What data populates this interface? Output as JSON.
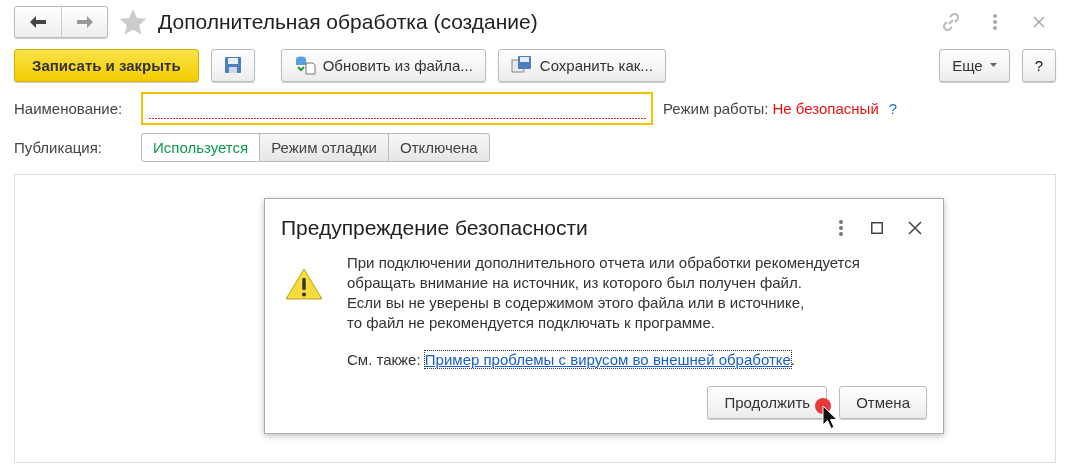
{
  "window": {
    "title": "Дополнительная обработка (создание)",
    "favorite": false
  },
  "toolbar": {
    "primary_button": "Записать и закрыть",
    "buttons": [
      {
        "kind": "save"
      },
      {
        "kind": "load",
        "label": "Обновить из файла..."
      },
      {
        "kind": "saveas",
        "label": "Сохранить как..."
      }
    ],
    "more_button": "Еще",
    "help_button": "?"
  },
  "name_field": {
    "label": "Наименование:",
    "required": true
  },
  "mode": {
    "label": "Режим работы:",
    "value": "Не безопасный",
    "help": "?"
  },
  "publication": {
    "label": "Публикация:",
    "options": [
      {
        "label": "Используется",
        "selected": true
      },
      {
        "label": "Режим отладки",
        "selected": false
      },
      {
        "label": "Отключена",
        "selected": false
      }
    ]
  },
  "dialog": {
    "title": "Предупреждение безопасности",
    "message_lines": [
      "При подключении дополнительного отчета или обработки рекомендуется",
      "обращать внимание на источник, из которого был получен файл.",
      "Если вы не уверены в содержимом этого файла или в источнике,",
      "то файл не рекомендуется подключать к программе."
    ],
    "see_also": "См. также:",
    "link": "Пример проблемы с вирусом во внешней обработке",
    "link_suffix": ".",
    "buttons": [
      {
        "label": "Продолжить",
        "clicked": true
      },
      {
        "label": "Отмена",
        "clicked": false
      }
    ]
  }
}
